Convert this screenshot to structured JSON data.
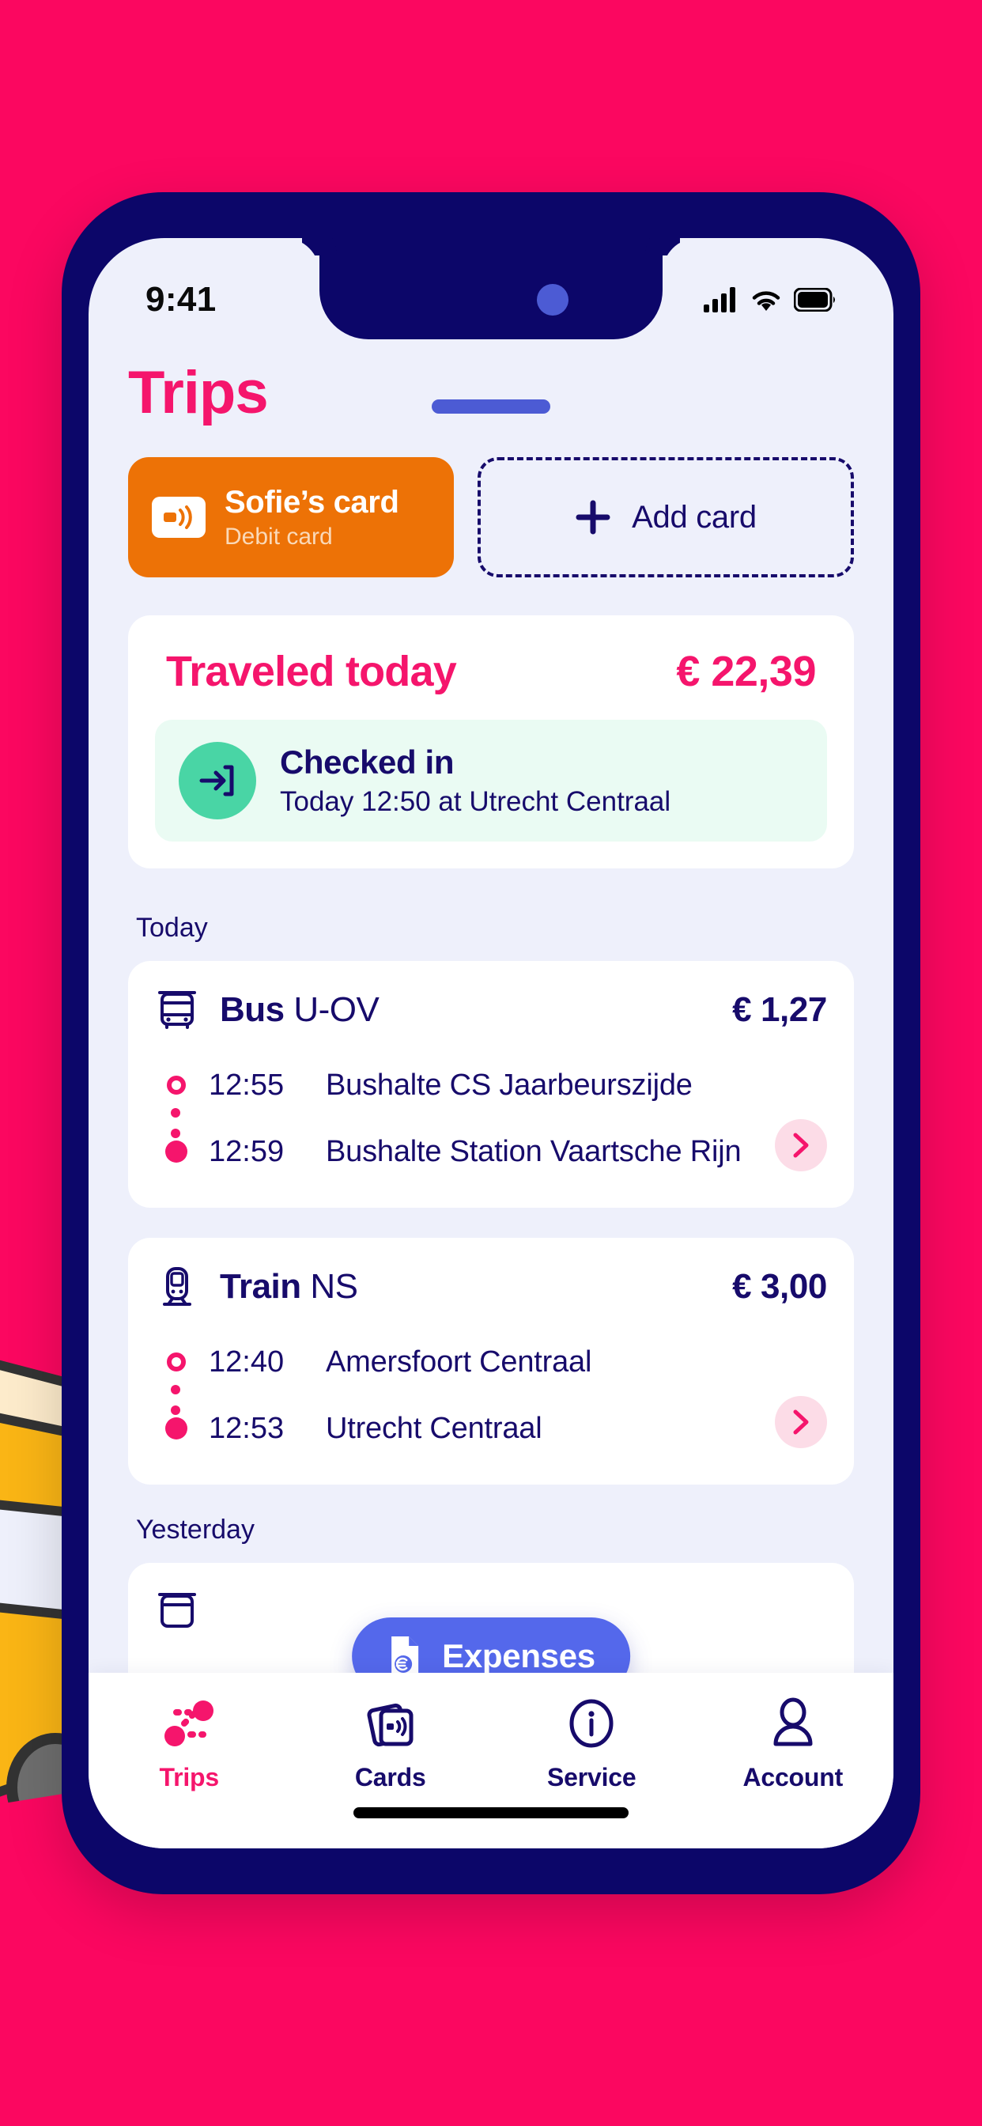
{
  "background": {
    "color": "#FB0760",
    "illustration": "yellow-tram-illustration"
  },
  "device": {
    "frame_color": "#0C0669",
    "screen_bg": "#EEF0FB"
  },
  "status_bar": {
    "time": "9:41",
    "icons": [
      "cellular-signal-icon",
      "wifi-icon",
      "battery-icon"
    ]
  },
  "header": {
    "title": "Trips"
  },
  "cards": {
    "selected_card": {
      "name": "Sofie’s card",
      "type": "Debit card",
      "icon": "contactless-card-icon",
      "color": "#ED7206"
    },
    "add_card": {
      "label": "Add card",
      "icon": "plus-icon"
    }
  },
  "traveled_today": {
    "title": "Traveled today",
    "amount": "€ 22,39",
    "accent_color": "#F5156C",
    "status": {
      "title": "Checked in",
      "detail": "Today 12:50 at Utrecht Centraal",
      "icon": "check-in-arrow-icon",
      "icon_color": "#49D5A5",
      "bg_color": "#EAFBF3"
    }
  },
  "sections": [
    {
      "day_label": "Today",
      "trips": [
        {
          "icon": "bus-icon",
          "mode": "Bus",
          "operator": "U-OV",
          "price": "€ 1,27",
          "legs": [
            {
              "time": "12:55",
              "place": "Bushalte CS Jaarbeurszijde",
              "marker": "origin"
            },
            {
              "time": "12:59",
              "place": "Bushalte Station Vaartsche Rijn",
              "marker": "destination"
            }
          ],
          "chevron": "chevron-right-icon"
        },
        {
          "icon": "train-icon",
          "mode": "Train",
          "operator": "NS",
          "price": "€ 3,00",
          "legs": [
            {
              "time": "12:40",
              "place": "Amersfoort Centraal",
              "marker": "origin"
            },
            {
              "time": "12:53",
              "place": "Utrecht Centraal",
              "marker": "destination"
            }
          ],
          "chevron": "chevron-right-icon"
        }
      ]
    },
    {
      "day_label": "Yesterday",
      "trips": []
    }
  ],
  "fab": {
    "label": "Expenses",
    "icon": "document-euro-icon",
    "color": "#5468EB"
  },
  "tabbar": {
    "items": [
      {
        "label": "Trips",
        "icon": "route-icon",
        "active": true
      },
      {
        "label": "Cards",
        "icon": "cards-icon",
        "active": false
      },
      {
        "label": "Service",
        "icon": "info-icon",
        "active": false
      },
      {
        "label": "Account",
        "icon": "person-icon",
        "active": false
      }
    ],
    "active_color": "#F5156C",
    "inactive_color": "#170B6B"
  }
}
